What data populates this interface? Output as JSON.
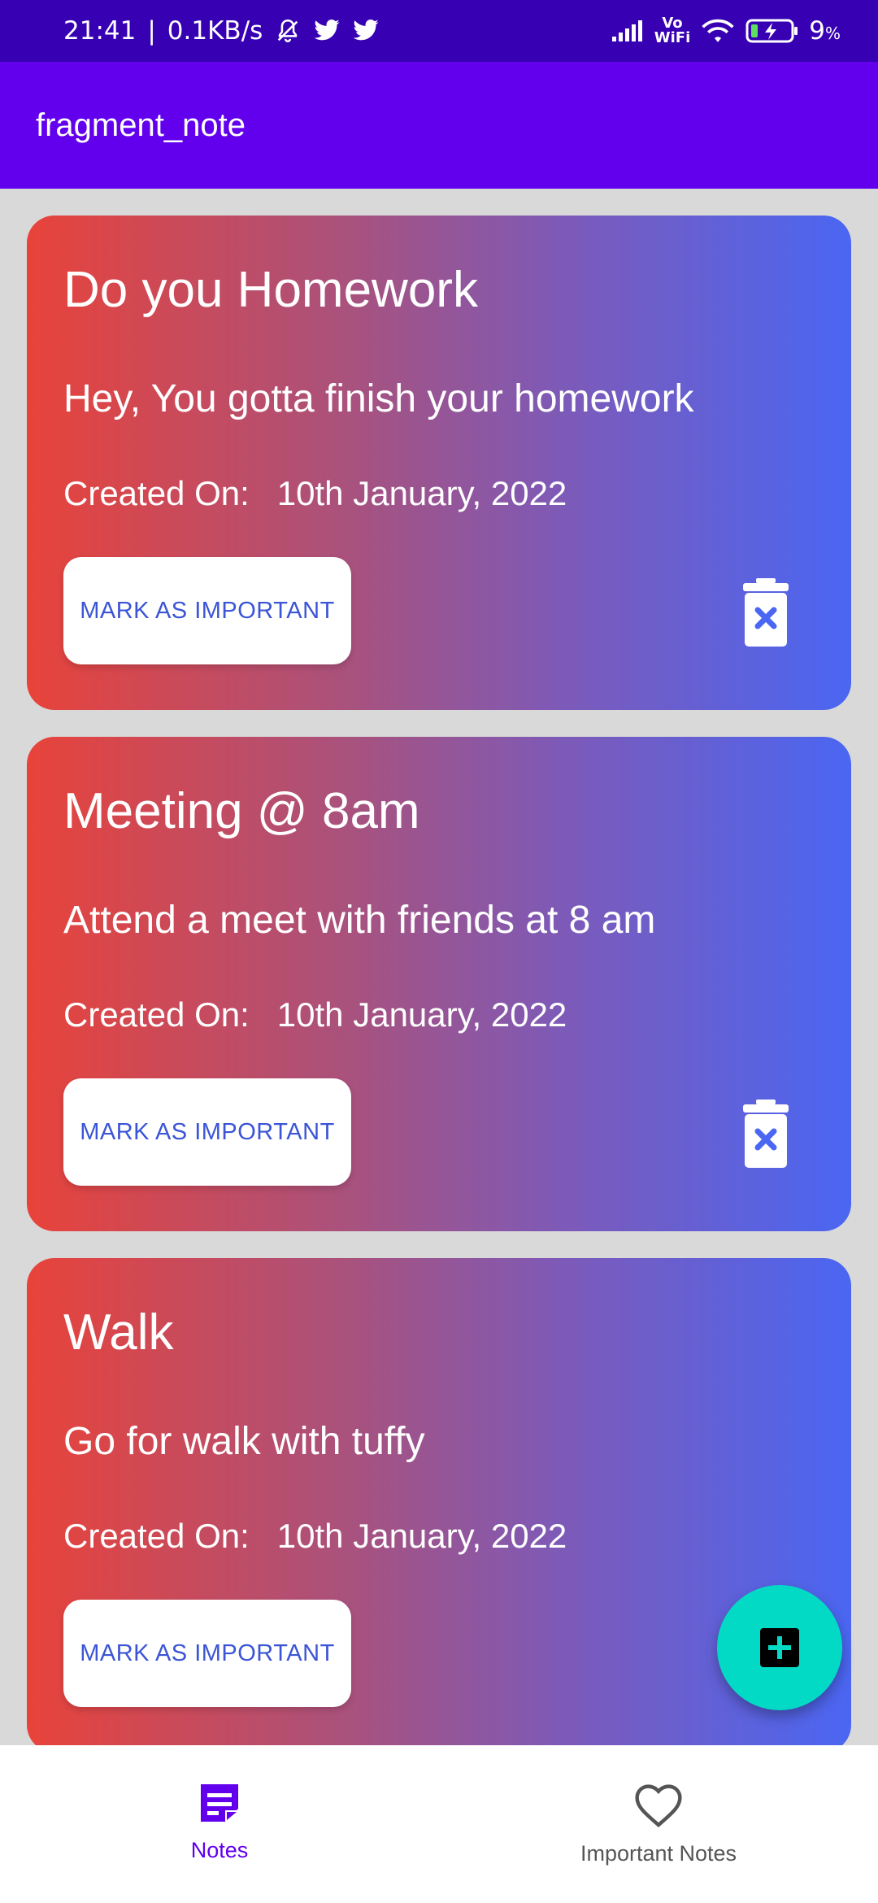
{
  "status_bar": {
    "time": "21:41",
    "network_speed": "0.1KB/s",
    "icons": [
      "mute-bell-icon",
      "twitter-icon",
      "twitter-icon",
      "signal-icon",
      "vowifi-icon",
      "wifi-icon",
      "battery-charging-icon"
    ],
    "vowifi_top": "Vo",
    "vowifi_bottom": "WiFi",
    "battery": "9",
    "battery_unit": "%"
  },
  "app_bar": {
    "title": "fragment_note"
  },
  "notes": [
    {
      "title": "Do you Homework",
      "description": "Hey, You gotta finish your homework",
      "created_label": "Created On:",
      "created_date": "10th January, 2022",
      "button_label": "MARK AS IMPORTANT"
    },
    {
      "title": "Meeting @ 8am",
      "description": "Attend a meet with friends at 8 am",
      "created_label": "Created On:",
      "created_date": "10th January, 2022",
      "button_label": "MARK AS IMPORTANT"
    },
    {
      "title": "Walk",
      "description": "Go for walk with tuffy",
      "created_label": "Created On:",
      "created_date": "10th January, 2022",
      "button_label": "MARK AS IMPORTANT"
    }
  ],
  "fab": {
    "icon": "add-icon"
  },
  "bottom_nav": {
    "items": [
      {
        "label": "Notes",
        "icon": "notes-icon",
        "active": true
      },
      {
        "label": "Important Notes",
        "icon": "heart-icon",
        "active": false
      }
    ]
  },
  "colors": {
    "status_bar": "#3700b3",
    "app_bar": "#6200ee",
    "gradient_start": "#e8433a",
    "gradient_end": "#4a66f2",
    "fab": "#03dac5",
    "nav_active": "#6200ee",
    "button_text": "#3b55d6"
  }
}
